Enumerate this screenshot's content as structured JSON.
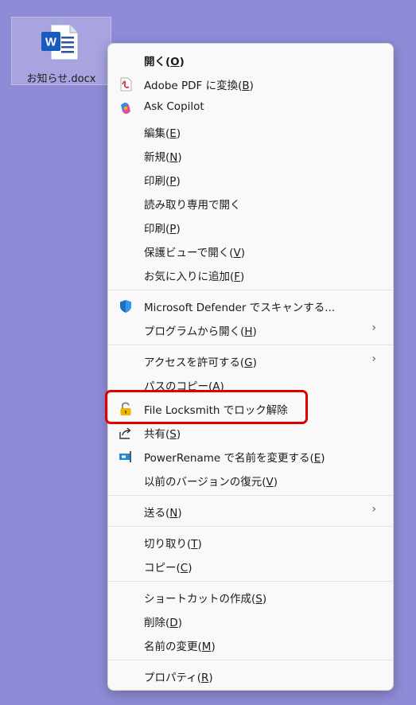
{
  "desktop_file": {
    "name": "お知らせ.docx",
    "icon": "word-document-icon"
  },
  "menu": {
    "items": [
      {
        "id": "open",
        "pre": "開く(",
        "accel": "O",
        "post": ")",
        "icon": null,
        "bold": true
      },
      {
        "id": "adobe-pdf",
        "pre": "Adobe PDF に変換(",
        "accel": "B",
        "post": ")",
        "icon": "adobe-pdf-icon"
      },
      {
        "id": "ask-copilot",
        "pre": "Ask Copilot",
        "accel": "",
        "post": "",
        "icon": "copilot-icon"
      },
      {
        "id": "edit",
        "pre": "編集(",
        "accel": "E",
        "post": ")",
        "icon": null
      },
      {
        "id": "new",
        "pre": "新規(",
        "accel": "N",
        "post": ")",
        "icon": null
      },
      {
        "id": "print-1",
        "pre": "印刷(",
        "accel": "P",
        "post": ")",
        "icon": null
      },
      {
        "id": "open-readonly",
        "pre": "読み取り専用で開く",
        "accel": "",
        "post": "",
        "icon": null
      },
      {
        "id": "print-2",
        "pre": "印刷(",
        "accel": "P",
        "post": ")",
        "icon": null
      },
      {
        "id": "protected-view",
        "pre": "保護ビューで開く(",
        "accel": "V",
        "post": ")",
        "icon": null
      },
      {
        "id": "add-favorites",
        "pre": "お気に入りに追加(",
        "accel": "F",
        "post": ")",
        "icon": null
      },
      {
        "id": "defender-scan",
        "pre": "Microsoft Defender でスキャンする...",
        "accel": "",
        "post": "",
        "icon": "defender-shield-icon"
      },
      {
        "id": "open-with",
        "pre": "プログラムから開く(",
        "accel": "H",
        "post": ")",
        "icon": null,
        "submenu": true
      },
      {
        "id": "give-access",
        "pre": "アクセスを許可する(",
        "accel": "G",
        "post": ")",
        "icon": null,
        "submenu": true
      },
      {
        "id": "copy-path",
        "pre": "パスのコピー(",
        "accel": "A",
        "post": ")",
        "icon": null
      },
      {
        "id": "file-locksmith",
        "pre": "File Locksmith でロック解除",
        "accel": "",
        "post": "",
        "icon": "padlock-icon"
      },
      {
        "id": "share",
        "pre": "共有(",
        "accel": "S",
        "post": ")",
        "icon": "share-icon"
      },
      {
        "id": "power-rename",
        "pre": "PowerRename で名前を変更する(",
        "accel": "E",
        "post": ")",
        "icon": "powerrename-icon"
      },
      {
        "id": "restore-versions",
        "pre": "以前のバージョンの復元(",
        "accel": "V",
        "post": ")",
        "icon": null
      },
      {
        "id": "send-to",
        "pre": "送る(",
        "accel": "N",
        "post": ")",
        "icon": null,
        "submenu": true
      },
      {
        "id": "cut",
        "pre": "切り取り(",
        "accel": "T",
        "post": ")",
        "icon": null
      },
      {
        "id": "copy",
        "pre": "コピー(",
        "accel": "C",
        "post": ")",
        "icon": null
      },
      {
        "id": "create-shortcut",
        "pre": "ショートカットの作成(",
        "accel": "S",
        "post": ")",
        "icon": null
      },
      {
        "id": "delete",
        "pre": "削除(",
        "accel": "D",
        "post": ")",
        "icon": null
      },
      {
        "id": "rename",
        "pre": "名前の変更(",
        "accel": "M",
        "post": ")",
        "icon": null
      },
      {
        "id": "properties",
        "pre": "プロパティ(",
        "accel": "R",
        "post": ")",
        "icon": null
      }
    ],
    "chevron": "›",
    "highlighted_item": "file-locksmith",
    "highlight_color": "#e00000"
  }
}
